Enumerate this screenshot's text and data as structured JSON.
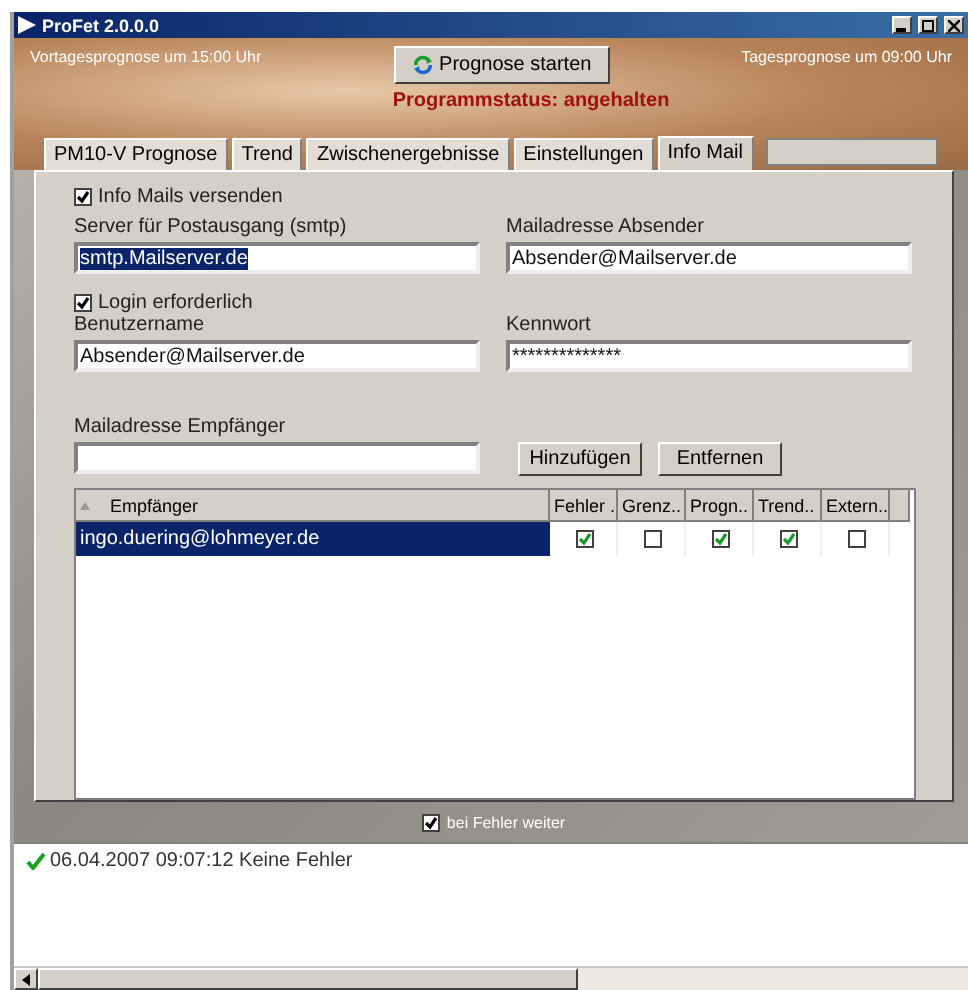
{
  "window": {
    "title": "ProFet 2.0.0.0"
  },
  "header": {
    "left_note": "Vortagesprognose um 15:00 Uhr",
    "start_button": "Prognose starten",
    "right_note": "Tagesprognose um 09:00 Uhr",
    "status": "Programmstatus: angehalten"
  },
  "tabs": [
    {
      "label": "PM10-V Prognose",
      "selected": false
    },
    {
      "label": "Trend",
      "selected": false
    },
    {
      "label": "Zwischenergebnisse",
      "selected": false
    },
    {
      "label": "Einstellungen",
      "selected": false
    },
    {
      "label": "Info Mail",
      "selected": true
    }
  ],
  "send_mails": {
    "label": "Info Mails versenden",
    "checked": true
  },
  "smtp_server": {
    "label": "Server für Postausgang (smtp)",
    "value": "smtp.Mailserver.de",
    "highlighted": true
  },
  "sender_address": {
    "label": "Mailadresse Absender",
    "value": "Absender@Mailserver.de",
    "highlighted": false
  },
  "login_required": {
    "label": "Login erforderlich",
    "checked": true
  },
  "username": {
    "label": "Benutzername",
    "value": "Absender@Mailserver.de",
    "highlighted": false
  },
  "password": {
    "label": "Kennwort",
    "value": "**************",
    "highlighted": false
  },
  "recipient_address": {
    "label": "Mailadresse Empfänger"
  },
  "buttons": [
    "Hinzufügen",
    "Entfernen"
  ],
  "table": {
    "columns": [
      "Empfänger",
      "Fehler ..",
      "Grenz..",
      "Progn..",
      "Trend..",
      "Extern.."
    ],
    "rows": [
      {
        "address": "ingo.duering@lohmeyer.de",
        "selected": true,
        "flags": [
          true,
          false,
          true,
          true,
          false
        ]
      }
    ]
  },
  "continue_on_error": {
    "label": "bei Fehler weiter",
    "checked": true
  },
  "log": [
    {
      "kind": "ok",
      "text": "06.04.2007 09:07:12 Keine Fehler"
    }
  ]
}
